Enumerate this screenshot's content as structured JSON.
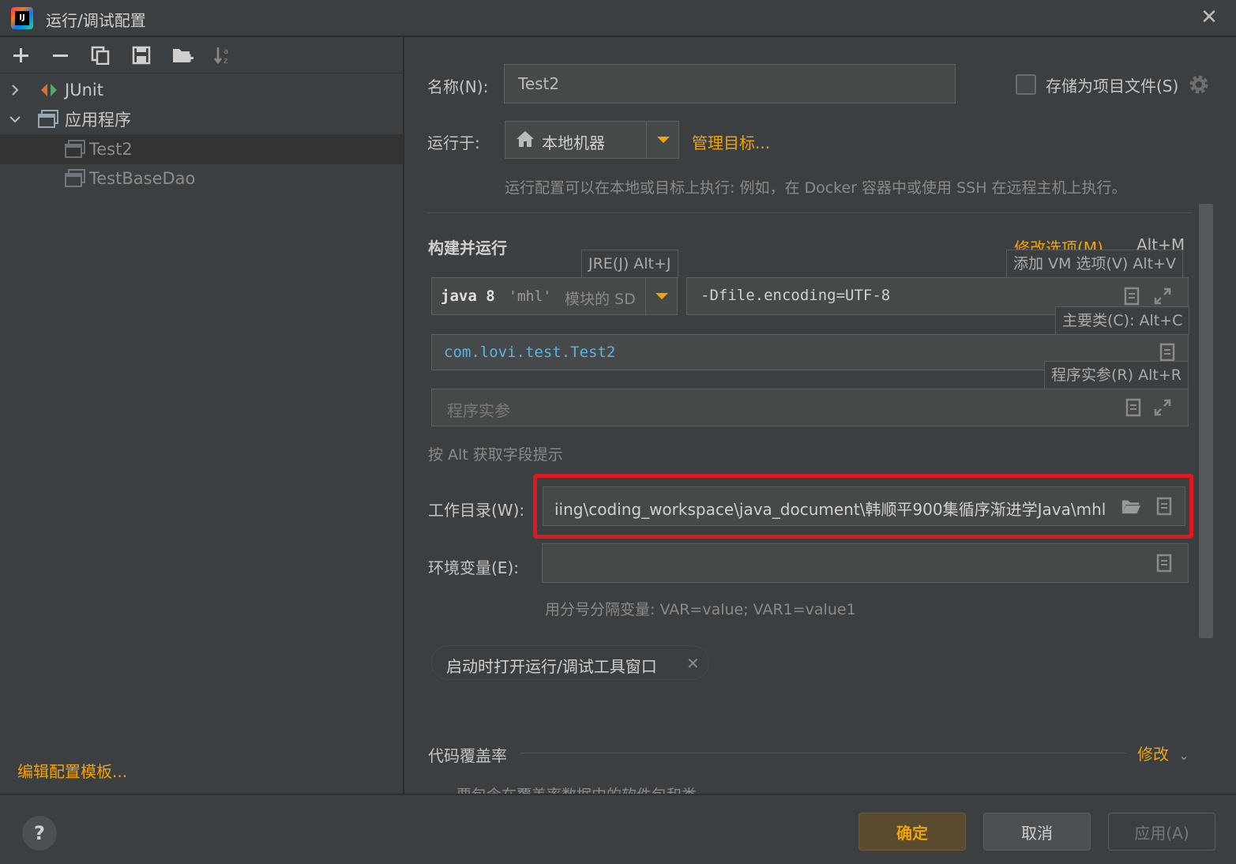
{
  "window": {
    "title": "运行/调试配置",
    "app_logo": "IJ"
  },
  "toolbar": {
    "icons": [
      "add-icon",
      "remove-icon",
      "copy-icon",
      "save-icon",
      "folder-add-icon",
      "sort-icon"
    ]
  },
  "tree": {
    "items": [
      {
        "label": "JUnit",
        "expanded": false
      },
      {
        "label": "应用程序",
        "expanded": true
      },
      {
        "label": "Test2",
        "selected": true
      },
      {
        "label": "TestBaseDao"
      }
    ]
  },
  "left_footer": {
    "edit_templates": "编辑配置模板..."
  },
  "form": {
    "name_label": "名称(N):",
    "name_value": "Test2",
    "store_label": "存储为项目文件(S)",
    "run_on_label": "运行于:",
    "run_on_value": "本地机器",
    "manage_targets": "管理目标...",
    "run_on_hint": "运行配置可以在本地或目标上执行: 例如，在 Docker 容器中或使用 SSH 在远程主机上执行。",
    "section_build_run": "构建并运行",
    "modify_options": "修改选项(M)",
    "modify_shortcut": "Alt+M",
    "jre_tooltip": "JRE(J) Alt+J",
    "jre_value": "java 8",
    "jre_module": "'mhl'",
    "jre_suffix": "模块的 SD",
    "vm_tooltip": "添加 VM 选项(V) Alt+V",
    "vm_value": "-Dfile.encoding=UTF-8",
    "main_class_tooltip": "主要类(C): Alt+C",
    "main_class_value": "com.lovi.test.Test2",
    "args_tooltip": "程序实参(R) Alt+R",
    "args_placeholder": "程序实参",
    "alt_hint": "按 Alt 获取字段提示",
    "workdir_label": "工作目录(W):",
    "workdir_value": "iing\\coding_workspace\\java_document\\韩顺平900集循序渐进学Java\\mhl",
    "env_label": "环境变量(E):",
    "env_hint": "用分号分隔变量: VAR=value; VAR1=value1",
    "open_tool_window_chip": "启动时打开运行/调试工具窗口",
    "coverage_label": "代码覆盖率",
    "coverage_modify": "修改",
    "coverage_partial": "要包含在覆盖率数据中的软件包和类"
  },
  "buttons": {
    "ok": "确定",
    "cancel": "取消",
    "apply": "应用(A)",
    "help": "?"
  },
  "colors": {
    "accent": "#f0a30a",
    "highlight_box": "#e0171f",
    "main_class_text": "#5fb2e0"
  }
}
